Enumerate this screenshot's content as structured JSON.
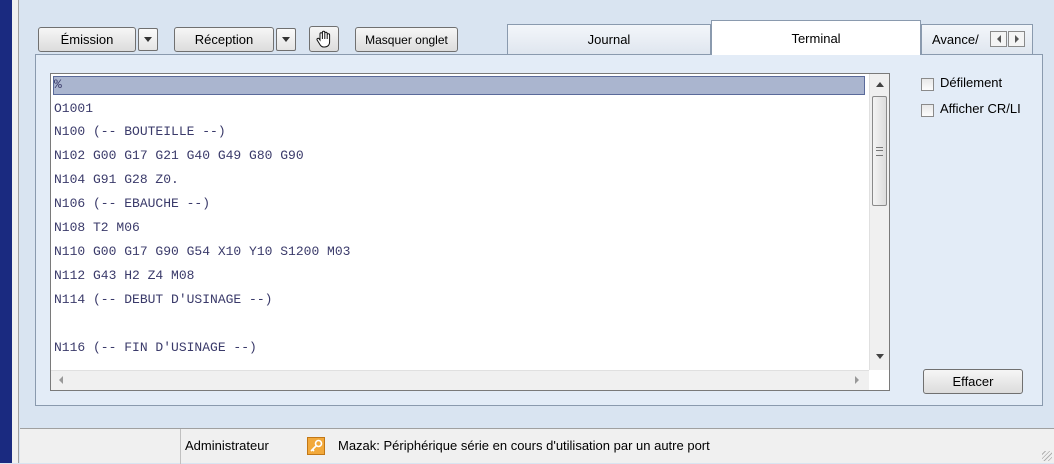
{
  "toolbar": {
    "emission_label": "Émission",
    "reception_label": "Réception",
    "hide_tab_label": "Masquer onglet"
  },
  "tabs": [
    {
      "label": "Journal",
      "active": false
    },
    {
      "label": "Terminal",
      "active": true
    },
    {
      "label": "Avance/",
      "active": false
    }
  ],
  "terminal": {
    "lines": [
      "%",
      "O1001",
      "N100 (-- BOUTEILLE --)",
      "N102 G00 G17 G21 G40 G49 G80 G90",
      "N104 G91 G28 Z0.",
      "N106 (-- EBAUCHE --)",
      "N108 T2 M06",
      "N110 G00 G17 G90 G54 X10 Y10 S1200 M03",
      "N112 G43 H2 Z4 M08",
      "N114 (-- DEBUT D'USINAGE --)",
      "",
      "N116 (-- FIN D'USINAGE --)"
    ]
  },
  "options": {
    "scroll_label": "Défilement",
    "show_crlf_label": "Afficher CR/LI",
    "clear_label": "Effacer"
  },
  "status": {
    "user": "Administrateur",
    "message": "Mazak: Périphérique série en cours d'utilisation par un autre port"
  }
}
